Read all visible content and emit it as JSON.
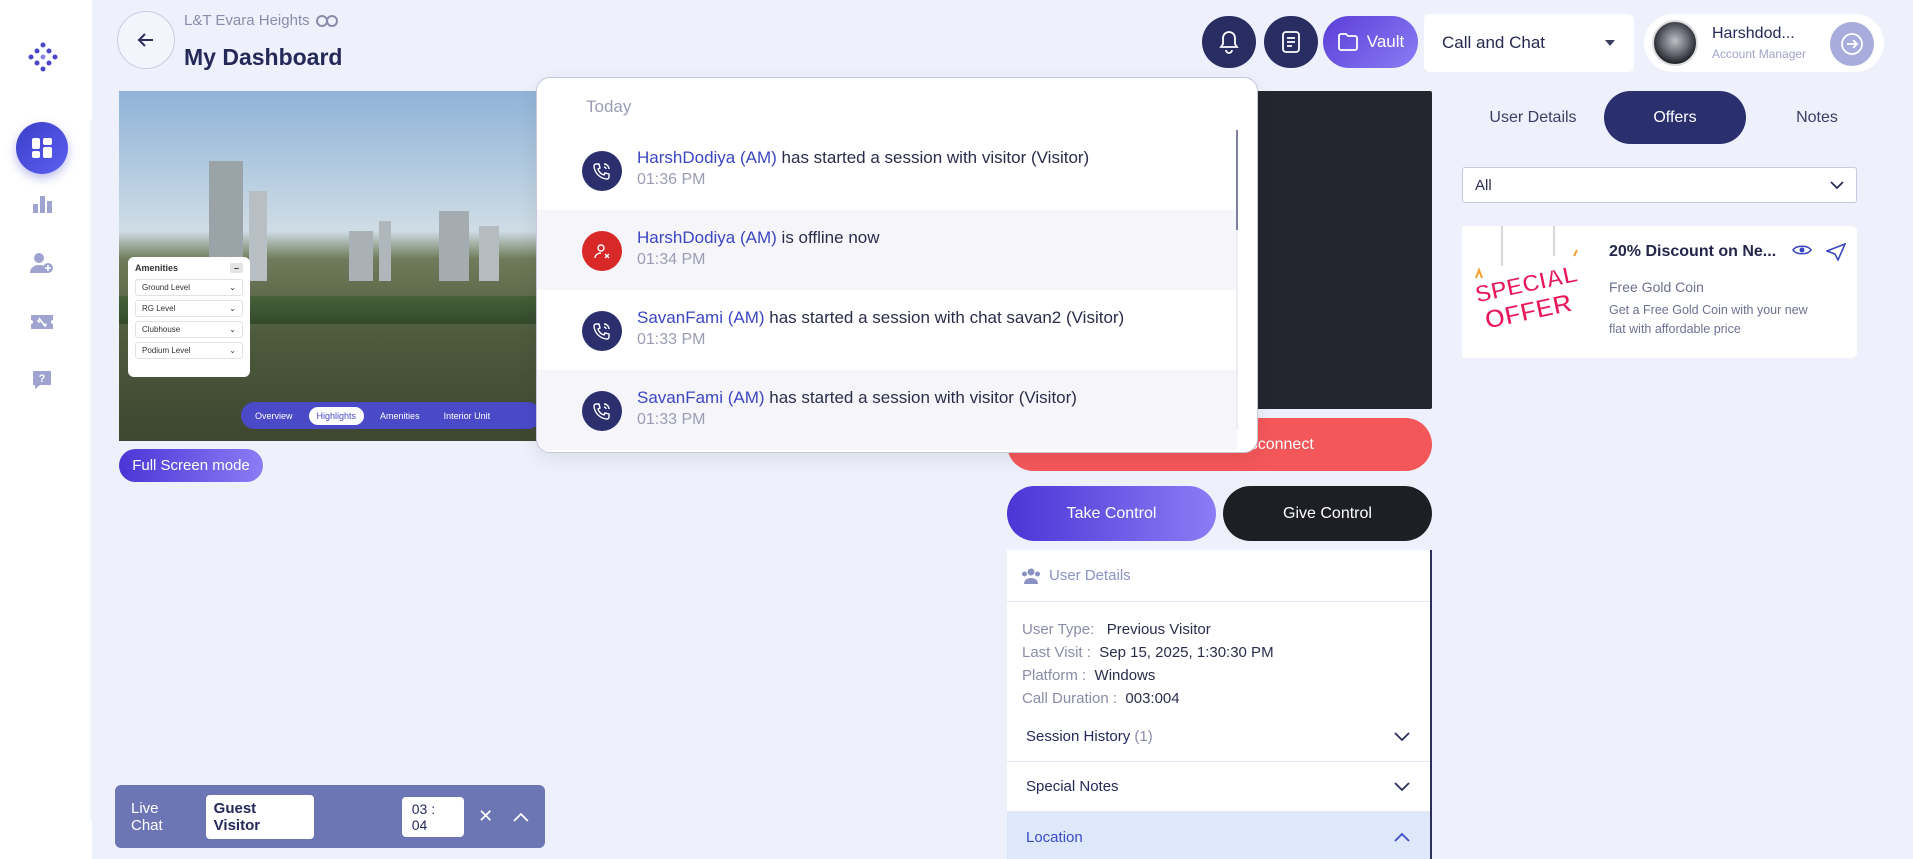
{
  "header": {
    "breadcrumb": "L&T Evara Heights",
    "title": "My Dashboard",
    "vault_label": "Vault",
    "mode_select": "Call and Chat",
    "user_name": "Harshdod...",
    "user_role": "Account Manager"
  },
  "preview": {
    "amenities_title": "Amenities",
    "amenities": [
      "Ground Level",
      "RG Level",
      "Clubhouse",
      "Podium Level"
    ],
    "nav": [
      "Overview",
      "Highlights",
      "Amenities",
      "Interior Unit"
    ],
    "fullscreen_label": "Full Screen mode"
  },
  "controls": {
    "end_label": "End Session & Disconnect",
    "take_label": "Take Control",
    "give_label": "Give Control"
  },
  "user_details": {
    "heading": "User Details",
    "rows": [
      {
        "k": "User Type:",
        "v": "Previous Visitor"
      },
      {
        "k": "Last Visit :",
        "v": "Sep 15, 2025, 1:30:30 PM"
      },
      {
        "k": "Platform :",
        "v": "Windows"
      },
      {
        "k": "Call Duration :",
        "v": "003:004"
      }
    ],
    "session_history": "Session History",
    "session_count": "(1)",
    "special_notes": "Special Notes",
    "location": "Location"
  },
  "right_panel": {
    "tabs": [
      "User Details",
      "Offers",
      "Notes"
    ],
    "active_tab": "Offers",
    "filter": "All",
    "offer": {
      "title": "20% Discount on Ne...",
      "subtitle": "Free Gold Coin",
      "description": "Get a Free Gold Coin with your new flat with affordable price",
      "badge_line1": "SPECIAL",
      "badge_line2": "OFFER"
    }
  },
  "livechat": {
    "label": "Live Chat",
    "guest": "Guest Visitor",
    "timer": "03 : 04"
  },
  "notifications": {
    "group": "Today",
    "items": [
      {
        "name": "HarshDodiya (AM)",
        "text": " has started a session with visitor (Visitor)",
        "time": "01:36 PM",
        "icon": "call"
      },
      {
        "name": "HarshDodiya (AM)",
        "text": " is offline now",
        "time": "01:34 PM",
        "icon": "offline"
      },
      {
        "name": "SavanFami (AM)",
        "text": " has started a session with chat savan2 (Visitor)",
        "time": "01:33 PM",
        "icon": "call"
      },
      {
        "name": "SavanFami (AM)",
        "text": " has started a session with visitor (Visitor)",
        "time": "01:33 PM",
        "icon": "call"
      }
    ]
  },
  "colors": {
    "primary": "#2a2f6d",
    "accent": "#5a3ed8",
    "danger": "#f4575a",
    "background": "#eef0fb"
  }
}
